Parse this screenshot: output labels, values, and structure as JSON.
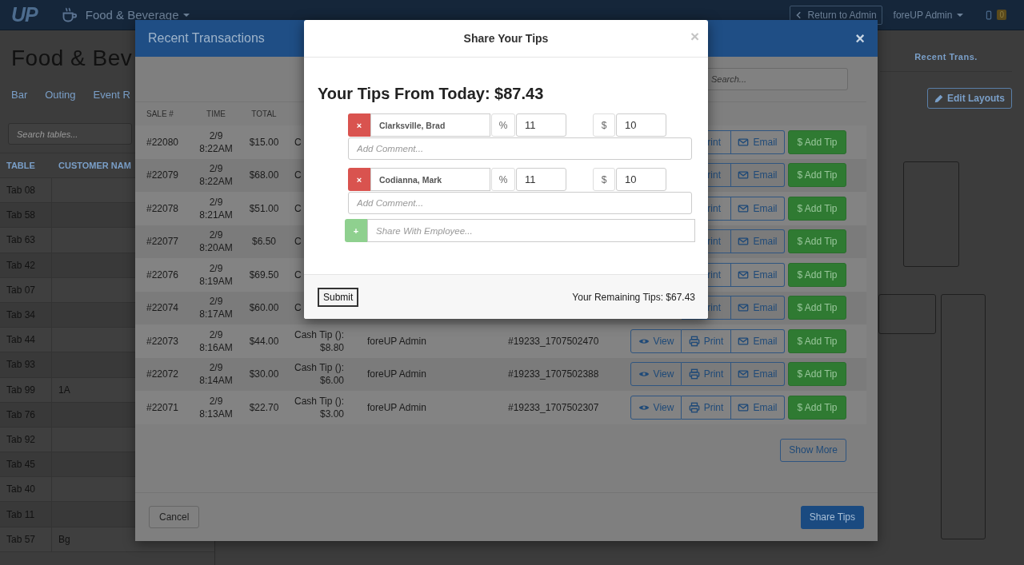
{
  "navbar": {
    "logo": "UP",
    "section": "Food & Beverage",
    "return_button": "Return to Admin",
    "user_menu": "foreUP Admin",
    "notification_count": "0"
  },
  "page": {
    "title": "Food & Bev",
    "tabs": [
      {
        "label": "Bar"
      },
      {
        "label": "Outing"
      },
      {
        "label": "Event R"
      }
    ],
    "recent_tab": "Recent Trans.",
    "edit_button": "Edit Layouts",
    "table_search": {
      "placeholder": "Search tables..."
    },
    "table": {
      "columns": [
        "TABLE",
        "CUSTOMER NAM"
      ],
      "rows": [
        {
          "table": "Tab 08"
        },
        {
          "table": "Tab 58"
        },
        {
          "table": "Tab 63"
        },
        {
          "table": "Tab 42"
        },
        {
          "table": "Tab 07"
        },
        {
          "table": "Tab 34"
        },
        {
          "table": "Tab 44"
        },
        {
          "table": "Tab 93"
        },
        {
          "table": "Tab 99",
          "customer": "1A"
        },
        {
          "table": "Tab 76"
        },
        {
          "table": "Tab 92"
        },
        {
          "table": "Tab 45"
        },
        {
          "table": "Tab 40"
        },
        {
          "table": "Tab 11"
        },
        {
          "table": "Tab 57",
          "customer": "Bg"
        }
      ]
    }
  },
  "transactions": {
    "title": "Recent Transactions",
    "close": "×",
    "search": {
      "placeholder": "Search..."
    },
    "columns": [
      "SALE #",
      "TIME",
      "TOTAL"
    ],
    "rows": [
      {
        "sale": "#22080",
        "time": "2/9\n8:22AM",
        "total": "$15.00",
        "tip": "C",
        "actions": [
          {
            "kind": "partial",
            "label": "rint"
          },
          {
            "kind": "email",
            "label": "Email"
          },
          {
            "kind": "tip",
            "label": "$ Add Tip"
          }
        ]
      },
      {
        "sale": "#22079",
        "time": "2/9\n8:22AM",
        "total": "$68.00",
        "tip": "C",
        "actions": [
          {
            "kind": "partial",
            "label": "rint"
          },
          {
            "kind": "email",
            "label": "Email"
          },
          {
            "kind": "tip",
            "label": "$ Add Tip"
          }
        ]
      },
      {
        "sale": "#22078",
        "time": "2/9\n8:21AM",
        "total": "$51.00",
        "tip": "C",
        "actions": [
          {
            "kind": "partial",
            "label": "rint"
          },
          {
            "kind": "email",
            "label": "Email"
          },
          {
            "kind": "tip",
            "label": "$ Add Tip"
          }
        ]
      },
      {
        "sale": "#22077",
        "time": "2/9\n8:20AM",
        "total": "$6.50",
        "tip": "C",
        "actions": [
          {
            "kind": "partial",
            "label": "rint"
          },
          {
            "kind": "email",
            "label": "Email"
          },
          {
            "kind": "tip",
            "label": "$ Add Tip"
          }
        ]
      },
      {
        "sale": "#22076",
        "time": "2/9\n8:19AM",
        "total": "$69.50",
        "tip": "C",
        "actions": [
          {
            "kind": "partial",
            "label": "rint"
          },
          {
            "kind": "email",
            "label": "Email"
          },
          {
            "kind": "tip",
            "label": "$ Add Tip"
          }
        ]
      },
      {
        "sale": "#22074",
        "time": "2/9\n8:17AM",
        "total": "$60.00",
        "tip": "C",
        "actions": [
          {
            "kind": "partial",
            "label": "rint"
          },
          {
            "kind": "email",
            "label": "Email"
          },
          {
            "kind": "tip",
            "label": "$ Add Tip"
          }
        ]
      },
      {
        "sale": "#22073",
        "time": "2/9\n8:16AM",
        "total": "$44.00",
        "tip": "Cash Tip ():\n$8.80",
        "employee": "foreUP Admin",
        "receipt": "#19233_1707502470",
        "actions": [
          {
            "kind": "view",
            "label": "View"
          },
          {
            "kind": "print",
            "label": "Print"
          },
          {
            "kind": "email",
            "label": "Email"
          },
          {
            "kind": "tip",
            "label": "$ Add Tip"
          }
        ]
      },
      {
        "sale": "#22072",
        "time": "2/9\n8:14AM",
        "total": "$30.00",
        "tip": "Cash Tip ():\n$6.00",
        "employee": "foreUP Admin",
        "receipt": "#19233_1707502388",
        "actions": [
          {
            "kind": "view",
            "label": "View"
          },
          {
            "kind": "print",
            "label": "Print"
          },
          {
            "kind": "email",
            "label": "Email"
          },
          {
            "kind": "tip",
            "label": "$ Add Tip"
          }
        ]
      },
      {
        "sale": "#22071",
        "time": "2/9\n8:13AM",
        "total": "$22.70",
        "tip": "Cash Tip ():\n$3.00",
        "employee": "foreUP Admin",
        "receipt": "#19233_1707502307",
        "actions": [
          {
            "kind": "view",
            "label": "View"
          },
          {
            "kind": "print",
            "label": "Print"
          },
          {
            "kind": "email",
            "label": "Email"
          },
          {
            "kind": "tip",
            "label": "$ Add Tip"
          }
        ]
      }
    ],
    "show_more": "Show More",
    "cancel": "Cancel",
    "share": "Share Tips"
  },
  "tips": {
    "title": "Share Your Tips",
    "close": "×",
    "heading": "Your Tips From Today: $87.43",
    "employees": [
      {
        "remove": "×",
        "name": "Clarksville, Brad",
        "percent_symbol": "%",
        "percent": "11",
        "dollar_symbol": "$",
        "amount": "10",
        "comment": {
          "placeholder": "Add Comment..."
        }
      },
      {
        "remove": "×",
        "name": "Codianna, Mark",
        "percent_symbol": "%",
        "percent": "11",
        "dollar_symbol": "$",
        "amount": "10",
        "comment": {
          "placeholder": "Add Comment..."
        }
      }
    ],
    "add": {
      "icon": "+",
      "placeholder": "Share With Employee..."
    },
    "submit": "Submit",
    "remaining": "Your Remaining Tips: $67.43"
  }
}
